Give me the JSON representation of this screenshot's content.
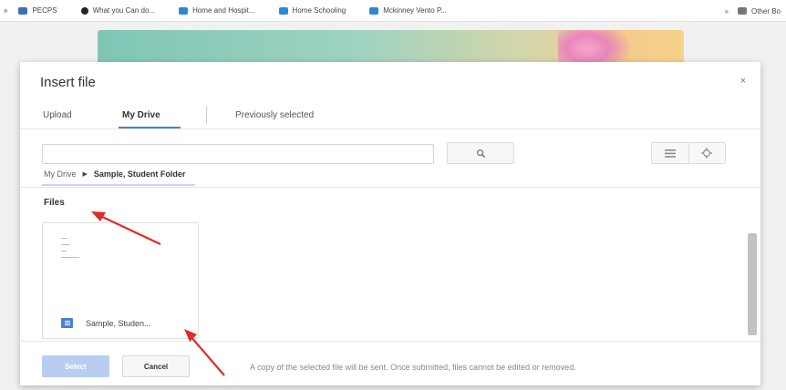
{
  "bookmarks": {
    "items": [
      {
        "label": "PECPS"
      },
      {
        "label": "What you Can do..."
      },
      {
        "label": "Home and Hospit..."
      },
      {
        "label": "Home Schooling"
      },
      {
        "label": "Mckinney Vento P..."
      }
    ],
    "other_label": "Other Bo"
  },
  "dialog": {
    "title": "Insert file",
    "close_glyph": "×",
    "tabs": [
      {
        "label": "Upload"
      },
      {
        "label": "My Drive"
      },
      {
        "label": "Previously selected"
      }
    ],
    "search": {
      "value": "",
      "placeholder": ""
    },
    "breadcrumb": {
      "root": "My Drive",
      "current": "Sample, Student Folder"
    },
    "files_label": "Files",
    "files": [
      {
        "name": "Sample, Studen...",
        "icon": "google-docs-icon"
      }
    ],
    "buttons": {
      "select": "Select",
      "cancel": "Cancel"
    },
    "footer_note": "A copy of the selected file will be sent. Once submitted, files cannot be edited or removed."
  },
  "colors": {
    "accent": "#4a7fd8",
    "select_disabled": "#b9cdf3",
    "annotation_arrow": "#e02a2a"
  }
}
